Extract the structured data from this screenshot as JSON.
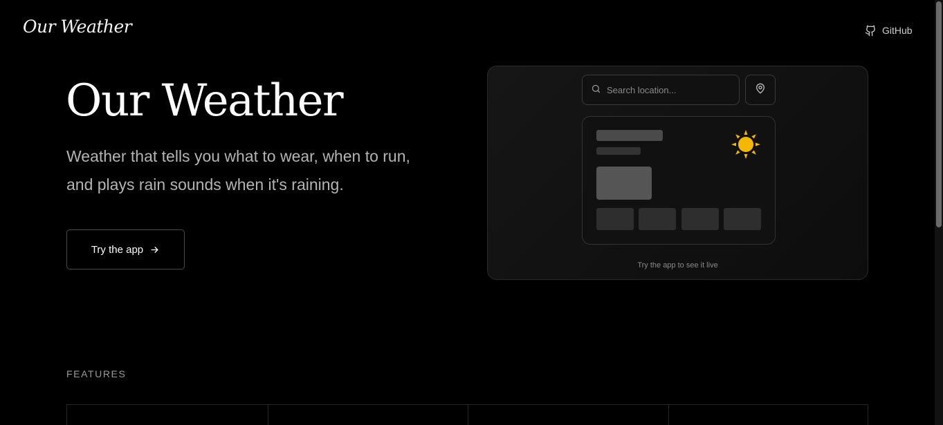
{
  "header": {
    "logo_text": "Our Weather",
    "github_label": "GitHub",
    "github_icon": "github-icon"
  },
  "hero": {
    "title": "Our Weather",
    "subtitle": "Weather that tells you what to wear, when to run, and plays rain sounds when it's raining.",
    "cta_label": "Try the app",
    "cta_icon": "arrow-right-icon"
  },
  "preview": {
    "search_placeholder": "Search location...",
    "search_icon": "search-icon",
    "location_icon": "map-pin-icon",
    "weather_icon": "sun-icon",
    "caption": "Try the app to see it live"
  },
  "features": {
    "heading": "FEATURES"
  },
  "colors": {
    "background": "#000000",
    "text_primary": "#ffffff",
    "text_muted": "#b4b4b4",
    "sun": "#f5b800",
    "border": "#4a4a4a"
  }
}
